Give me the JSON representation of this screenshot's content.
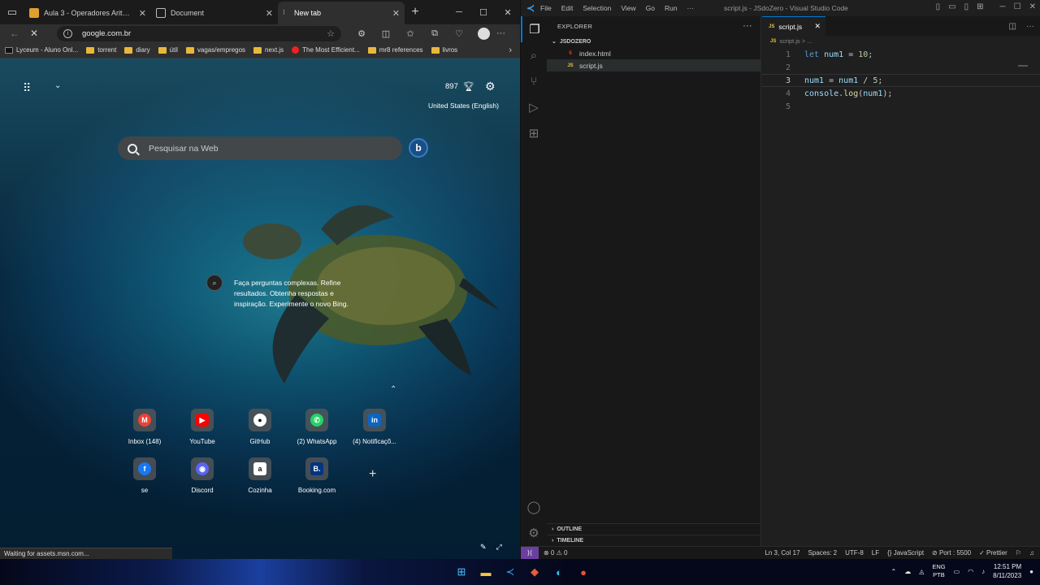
{
  "browser": {
    "tabs": [
      {
        "title": "Aula 3 - Operadores Aritméticos",
        "active": false
      },
      {
        "title": "Document",
        "active": false
      },
      {
        "title": "New tab",
        "active": true
      }
    ],
    "new_tab_symbol": "+",
    "address": "google.com.br",
    "bookmarks": [
      "Lyceum - Aluno Onl...",
      "torrent",
      "diary",
      "útil",
      "vagas/empregos",
      "next.js",
      "The Most Efficient...",
      "mr8 references",
      "livros"
    ],
    "ntp": {
      "rewards_points": "897",
      "region": "United States (English)",
      "search_placeholder": "Pesquisar na Web",
      "bing_letter": "b",
      "bing_prompt": "Faça perguntas complexas. Refine resultados. Obtenha respostas e inspiração. Experimente o novo Bing.",
      "quick_links": [
        {
          "label": "Inbox (148)",
          "icon": "gmail-icon",
          "color": "#ea4335",
          "glyph": "M"
        },
        {
          "label": "YouTube",
          "icon": "youtube-icon",
          "color": "#ff0000",
          "glyph": "▶"
        },
        {
          "label": "GitHub",
          "icon": "github-icon",
          "color": "#222222",
          "glyph": "●"
        },
        {
          "label": "(2) WhatsApp",
          "icon": "whatsapp-icon",
          "color": "#25d366",
          "glyph": "✆"
        },
        {
          "label": "(4) Notificaçõ...",
          "icon": "linkedin-icon",
          "color": "#0a66c2",
          "glyph": "in"
        },
        {
          "label": "se",
          "icon": "facebook-icon",
          "color": "#1877f2",
          "glyph": "f"
        },
        {
          "label": "Discord",
          "icon": "discord-icon",
          "color": "#5865f2",
          "glyph": "◉"
        },
        {
          "label": "Cozinha",
          "icon": "amazon-icon",
          "color": "#111111",
          "glyph": "a"
        },
        {
          "label": "Booking.com",
          "icon": "booking-icon",
          "color": "#003580",
          "glyph": "B."
        }
      ]
    },
    "status_message": "Waiting for assets.msn.com..."
  },
  "vscode": {
    "menu": [
      "File",
      "Edit",
      "Selection",
      "View",
      "Go",
      "Run",
      "···"
    ],
    "window_title": "script.js - JSdoZero - Visual Studio Code",
    "explorer_title": "EXPLORER",
    "folder": "JSDOZERO",
    "files": [
      {
        "name": "index.html",
        "type": "html"
      },
      {
        "name": "script.js",
        "type": "js",
        "selected": true
      }
    ],
    "outline": "OUTLINE",
    "timeline": "TIMELINE",
    "tab": "script.js",
    "breadcrumb": "script.js > ...",
    "code": [
      {
        "no": "1",
        "text": "let num1 = 10;"
      },
      {
        "no": "2",
        "text": ""
      },
      {
        "no": "3",
        "text": "num1 = num1 / 5;"
      },
      {
        "no": "4",
        "text": "console.log(num1);"
      },
      {
        "no": "5",
        "text": ""
      }
    ],
    "status": {
      "errors": "⊗ 0  ⚠ 0",
      "position": "Ln 3, Col 17",
      "spaces": "Spaces: 2",
      "encoding": "UTF-8",
      "eol": "LF",
      "language": "{} JavaScript",
      "port": "⊘ Port : 5500",
      "prettier": "✓ Prettier"
    }
  },
  "taskbar": {
    "lang_top": "ENG",
    "lang_bottom": "PTB",
    "time": "12:51 PM",
    "date": "8/11/2023"
  }
}
